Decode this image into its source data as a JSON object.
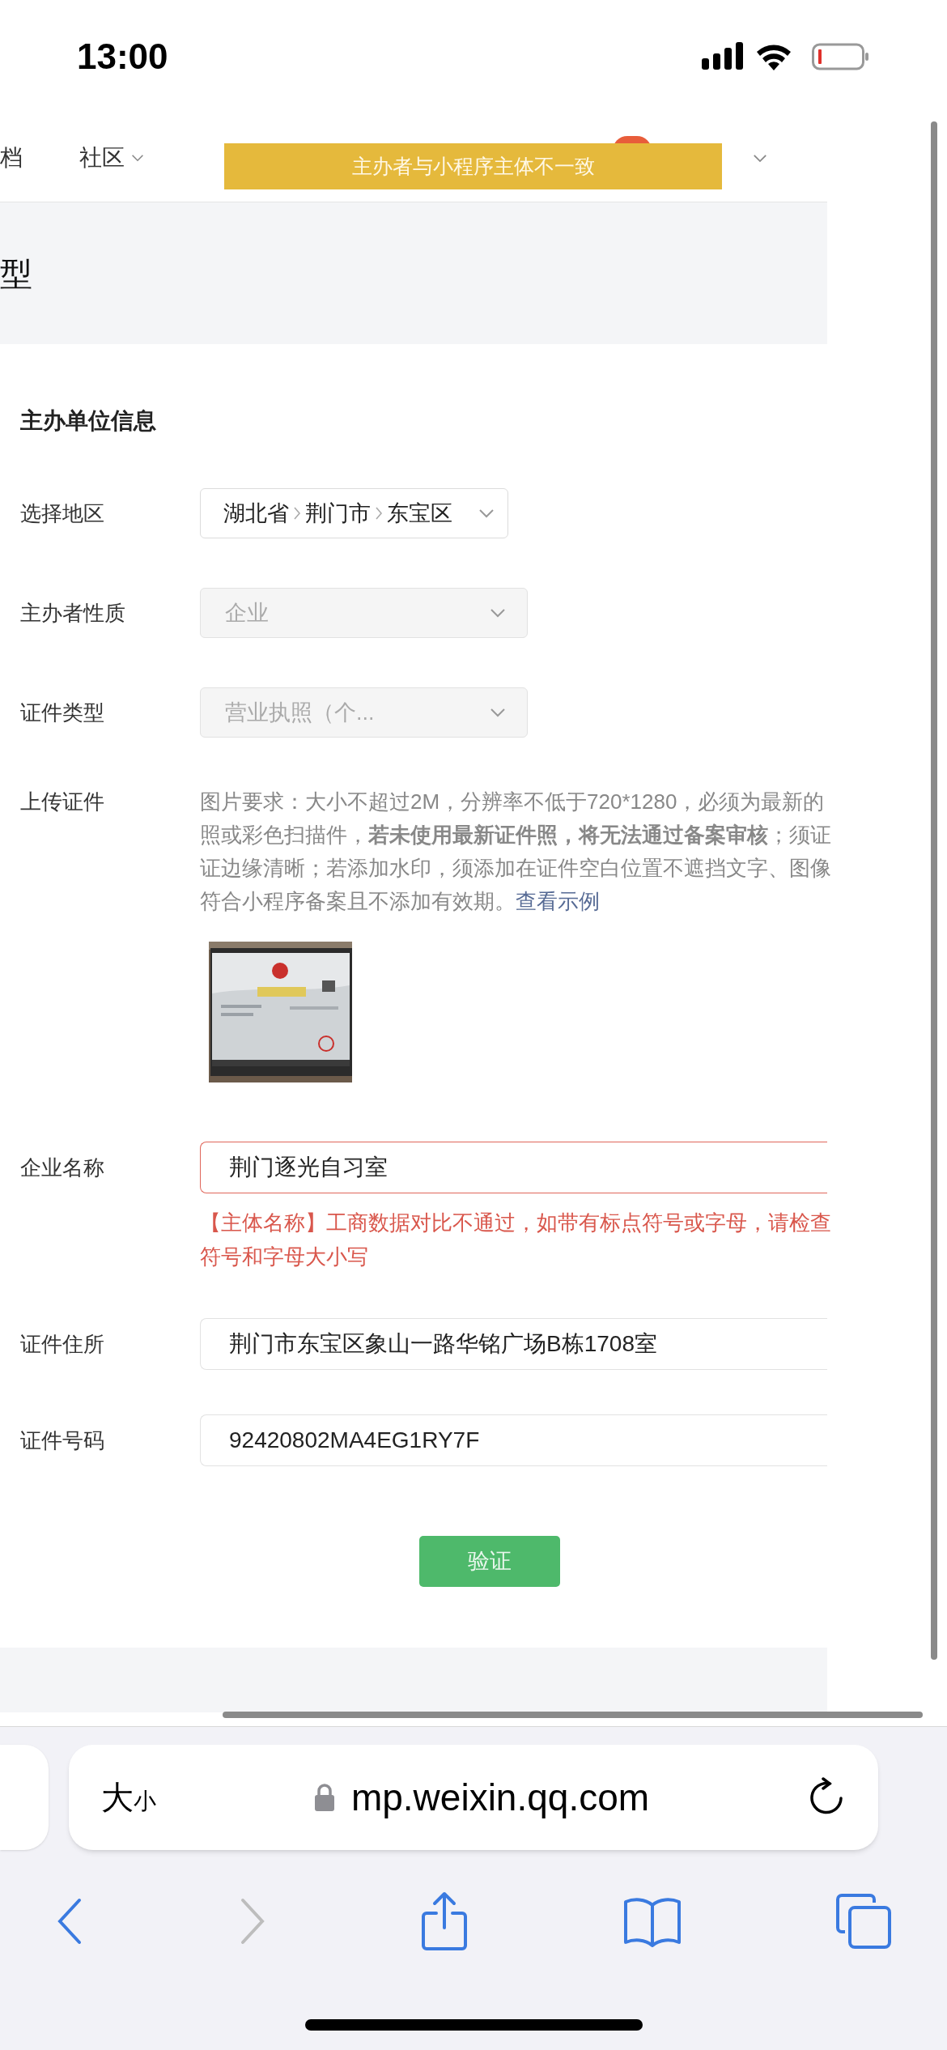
{
  "status_bar": {
    "time": "13:00"
  },
  "nav": {
    "items": [
      {
        "label": "档",
        "dropdown": false
      },
      {
        "label": "社区",
        "dropdown": true
      }
    ]
  },
  "toast": {
    "text": "主办者与小程序主体不一致"
  },
  "page_title": "型",
  "section_title": "主办单位信息",
  "fields": [
    {
      "kind": "region",
      "label": "选择地区",
      "parts": [
        "湖北省",
        "荆门市",
        "东宝区"
      ]
    },
    {
      "kind": "select",
      "label": "主办者性质",
      "value": "企业",
      "disabled": true
    },
    {
      "kind": "select",
      "label": "证件类型",
      "value": "营业执照（个...",
      "disabled": true
    },
    {
      "kind": "upload",
      "label": "上传证件",
      "lines": [
        "图片要求：大小不超过2M，分辨率不低于720*1280，必须为最新的",
        "照或彩色扫描件，**若未使用最新证件照，将无法通过备案审核**；须证",
        "证边缘清晰；若添加水印，须添加在证件空白位置不遮挡文字、图像",
        "符合小程序备案且不添加有效期。"
      ],
      "link": "查看示例"
    },
    {
      "kind": "input",
      "label": "企业名称",
      "value": "荆门逐光自习室",
      "error": true,
      "error_lines": [
        "【主体名称】工商数据对比不通过，如带有标点符号或字母，请检查",
        "符号和字母大小写"
      ]
    },
    {
      "kind": "input",
      "label": "证件住所",
      "value": "荆门市东宝区象山一路华铭广场B栋1708室",
      "error": false
    },
    {
      "kind": "input",
      "label": "证件号码",
      "value": "92420802MA4EG1RY7F",
      "error": false
    }
  ],
  "verify_button": "验证",
  "browser": {
    "text_size": {
      "large": "大",
      "small": "小"
    },
    "url": "mp.weixin.qq.com",
    "forward_disabled": true
  }
}
